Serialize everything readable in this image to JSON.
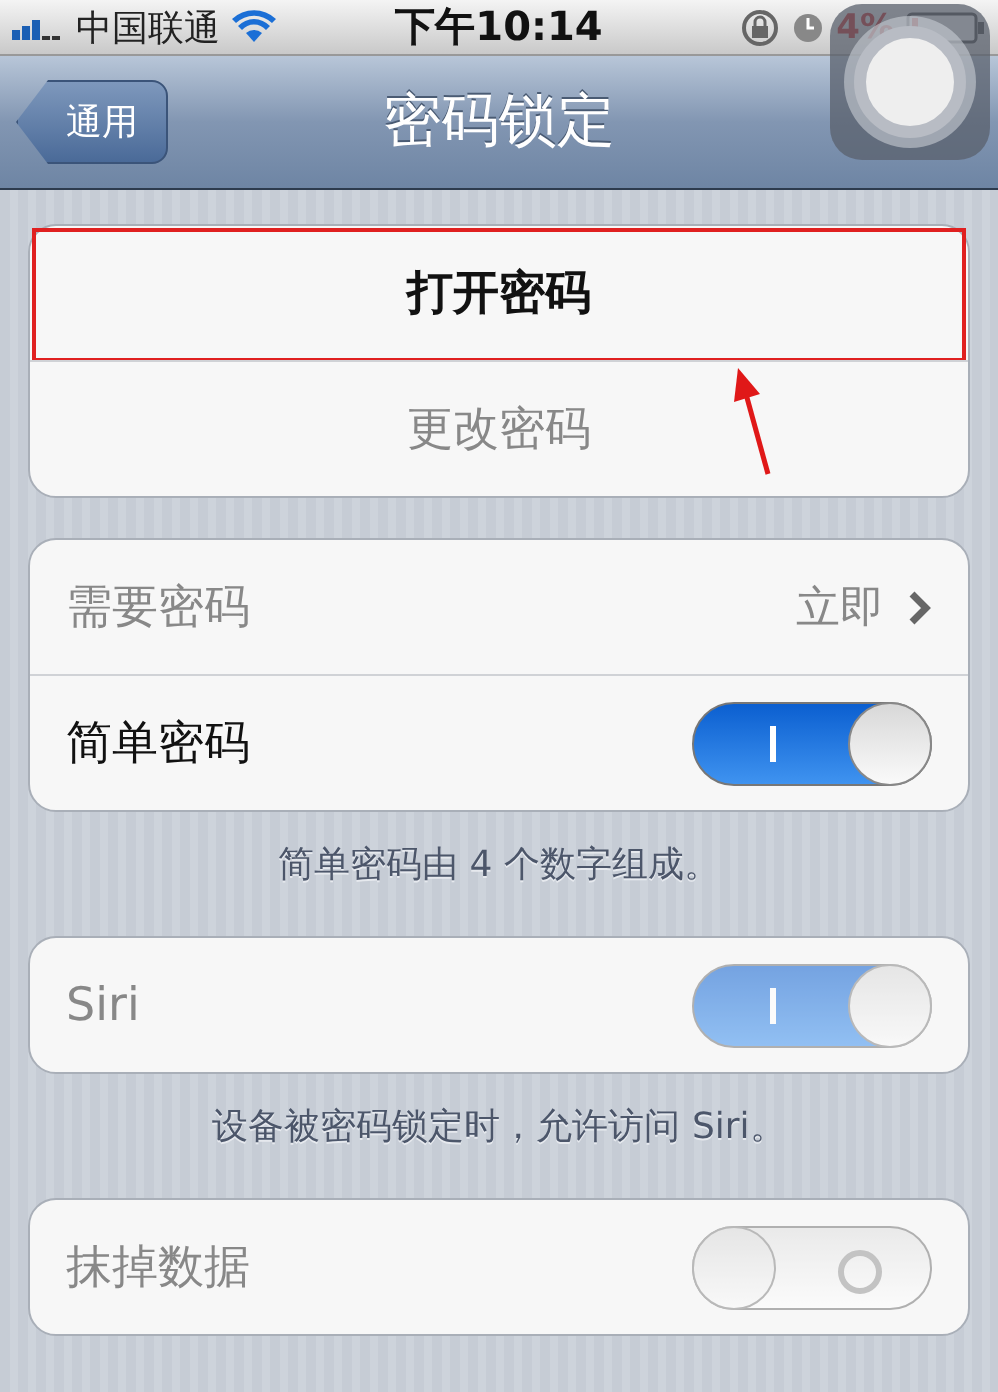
{
  "status_bar": {
    "carrier": "中国联通",
    "time": "下午10:14",
    "battery": "4%"
  },
  "nav_bar": {
    "back_button": "通用",
    "title": "密码锁定"
  },
  "groups": [
    {
      "rows": [
        {
          "kind": "button",
          "label": "打开密码",
          "disabled": false,
          "highlighted": true
        },
        {
          "kind": "button",
          "label": "更改密码",
          "disabled": true,
          "highlighted": false
        }
      ]
    },
    {
      "rows": [
        {
          "kind": "detail",
          "label": "需要密码",
          "value": "立即",
          "disabled": true
        },
        {
          "kind": "switch",
          "label": "简单密码",
          "on": true,
          "disabled": false
        }
      ],
      "footer": "简单密码由 4 个数字组成。"
    },
    {
      "rows": [
        {
          "kind": "switch",
          "label": "Siri",
          "on": true,
          "disabled": true
        }
      ],
      "footer": "设备被密码锁定时，允许访问 Siri。"
    },
    {
      "rows": [
        {
          "kind": "switch",
          "label": "抹掉数据",
          "on": false,
          "disabled": true
        }
      ]
    }
  ]
}
